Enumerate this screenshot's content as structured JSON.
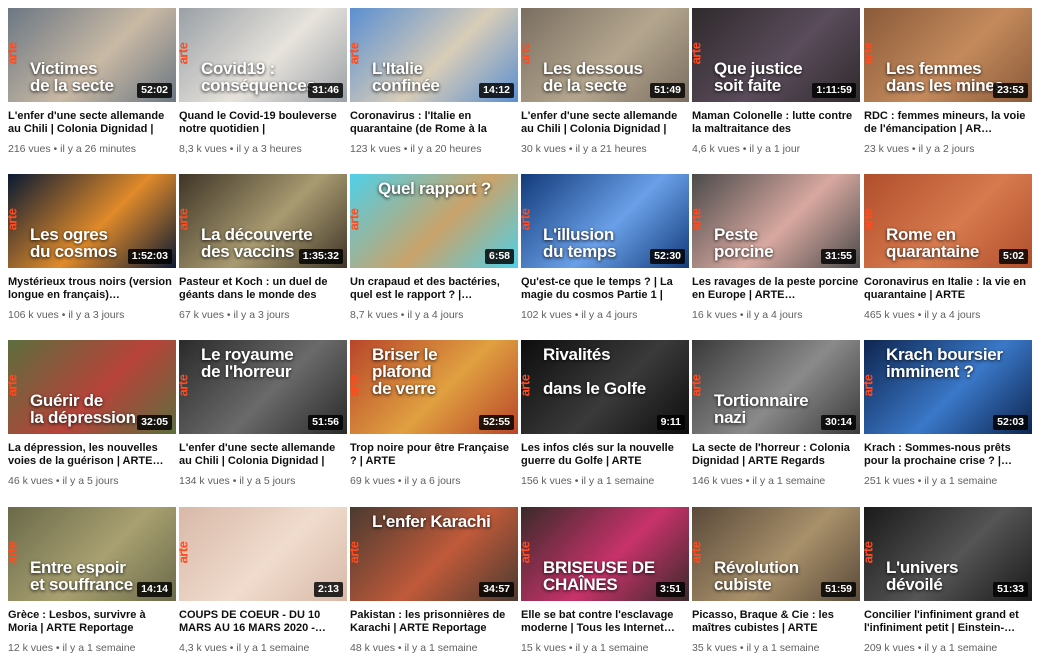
{
  "videos": [
    {
      "overlay": "Victimes\nde la secte",
      "duration": "52:02",
      "title": "L'enfer d'une secte allemande au Chili | Colonia Dignidad |",
      "views": "216 vues",
      "age": "il y a 26 minutes",
      "bg": "#6b7783",
      "accent": "#c9b9a4"
    },
    {
      "overlay": "Covid19 :\nconséquences",
      "duration": "31:46",
      "title": "Quand le Covid-19 bouleverse notre quotidien |",
      "views": "8,3 k vues",
      "age": "il y a 3 heures",
      "bg": "#9aa0a6",
      "accent": "#e7e3dc"
    },
    {
      "overlay": "L'Italie\nconfinée",
      "duration": "14:12",
      "title": "Coronavirus : l'Italie en quarantaine (de Rome à la",
      "views": "123 k vues",
      "age": "il y a 20 heures",
      "bg": "#5b8fd0",
      "accent": "#d8cdb8"
    },
    {
      "overlay": "Les dessous\nde la secte",
      "duration": "51:49",
      "title": "L'enfer d'une secte allemande au Chili | Colonia Dignidad |",
      "views": "30 k vues",
      "age": "il y a 21 heures",
      "bg": "#7a6e61",
      "accent": "#b4a68e"
    },
    {
      "overlay": "Que justice\nsoit faite",
      "duration": "1:11:59",
      "title": "Maman Colonelle : lutte contre la maltraitance des",
      "views": "4,6 k vues",
      "age": "il y a 1 jour",
      "bg": "#2f2a2c",
      "accent": "#5a4c5b"
    },
    {
      "overlay": "Les femmes\ndans les mines",
      "duration": "23:53",
      "title": "RDC : femmes mineurs, la voie de l'émancipation | AR…",
      "views": "23 k vues",
      "age": "il y a 2 jours",
      "bg": "#8a5a3a",
      "accent": "#c48a5c"
    },
    {
      "overlay": "Les ogres\ndu cosmos",
      "duration": "1:52:03",
      "title": "Mystérieux trous noirs (version longue en français)…",
      "views": "106 k vues",
      "age": "il y a 3 jours",
      "bg": "#0a1a33",
      "accent": "#e08a2a"
    },
    {
      "overlay": "La découverte\ndes vaccins",
      "duration": "1:35:32",
      "title": "Pasteur et Koch : un duel de géants dans le monde des",
      "views": "67 k vues",
      "age": "il y a 3 jours",
      "bg": "#3f3527",
      "accent": "#a89a70"
    },
    {
      "overlay": "Quel rapport ?",
      "duration": "6:58",
      "title": "Un crapaud et des bactéries, quel est le rapport ? |…",
      "views": "8,7 k vues",
      "age": "il y a 4 jours",
      "bg": "#4fd0e8",
      "accent": "#c9a36a",
      "top": true
    },
    {
      "overlay": "L'illusion\ndu temps",
      "duration": "52:30",
      "title": "Qu'est-ce que le temps ? | La magie du cosmos Partie 1 |",
      "views": "102 k vues",
      "age": "il y a 4 jours",
      "bg": "#123a7a",
      "accent": "#6aa0e8"
    },
    {
      "overlay": "Peste\nporcine",
      "duration": "31:55",
      "title": "Les ravages de la peste porcine en Europe | ARTE…",
      "views": "16 k vues",
      "age": "il y a 4 jours",
      "bg": "#4a4a4a",
      "accent": "#d8a8a0"
    },
    {
      "overlay": "Rome en\nquarantaine",
      "duration": "5:02",
      "title": "Coronavirus en Italie : la vie en quarantaine | ARTE",
      "views": "465 k vues",
      "age": "il y a 4 jours",
      "bg": "#b04e2c",
      "accent": "#d77a4e"
    },
    {
      "overlay": "Guérir de\nla dépression",
      "duration": "32:05",
      "title": "La dépression, les nouvelles voies de la guérison | ARTE…",
      "views": "46 k vues",
      "age": "il y a 5 jours",
      "bg": "#5c6e3d",
      "accent": "#b7433a"
    },
    {
      "overlay": "Le royaume\nde l'horreur",
      "duration": "51:56",
      "title": "L'enfer d'une secte allemande au Chili | Colonia Dignidad |",
      "views": "134 k vues",
      "age": "il y a 5 jours",
      "bg": "#2a2a2a",
      "accent": "#6a6a6a",
      "top": true
    },
    {
      "overlay": "Briser le\nplafond\nde verre",
      "duration": "52:55",
      "title": "Trop noire pour être Française ? | ARTE",
      "views": "69 k vues",
      "age": "il y a 6 jours",
      "bg": "#b8452a",
      "accent": "#e0a040",
      "top": true
    },
    {
      "overlay": "Rivalités\n\ndans le Golfe",
      "duration": "9:11",
      "title": "Les infos clés sur la nouvelle guerre du Golfe | ARTE",
      "views": "156 k vues",
      "age": "il y a 1 semaine",
      "bg": "#0d0d0d",
      "accent": "#3a3a3a",
      "top": true
    },
    {
      "overlay": "Tortionnaire\nnazi",
      "duration": "30:14",
      "title": "La secte de l'horreur : Colonia Dignidad | ARTE Regards",
      "views": "146 k vues",
      "age": "il y a 1 semaine",
      "bg": "#3a3a3a",
      "accent": "#8a8a8a"
    },
    {
      "overlay": "Krach boursier\nimminent ?",
      "duration": "52:03",
      "title": "Krach : Sommes-nous prêts pour la prochaine crise ? |…",
      "views": "251 k vues",
      "age": "il y a 1 semaine",
      "bg": "#0e2550",
      "accent": "#3a78c8",
      "top": true
    },
    {
      "overlay": "Entre espoir\net souffrance",
      "duration": "14:14",
      "title": "Grèce : Lesbos, survivre à Moria | ARTE Reportage",
      "views": "12 k vues",
      "age": "il y a 1 semaine",
      "bg": "#6a6a4a",
      "accent": "#a8a070"
    },
    {
      "overlay": "",
      "duration": "2:13",
      "title": "COUPS DE COEUR - DU 10 MARS AU 16 MARS 2020 -…",
      "views": "4,3 k vues",
      "age": "il y a 1 semaine",
      "bg": "#d8b8a8",
      "accent": "#f0dccd"
    },
    {
      "overlay": "L'enfer Karachi",
      "duration": "34:57",
      "title": "Pakistan : les prisonnières de Karachi | ARTE Reportage",
      "views": "48 k vues",
      "age": "il y a 1 semaine",
      "bg": "#4a3a30",
      "accent": "#c05a3a",
      "top": true
    },
    {
      "overlay": "BRISEUSE DE\nCHAÎNES",
      "duration": "3:51",
      "title": "Elle se bat contre l'esclavage moderne | Tous les Internet…",
      "views": "15 k vues",
      "age": "il y a 1 semaine",
      "bg": "#3a2a2a",
      "accent": "#c8326a"
    },
    {
      "overlay": "Révolution\ncubiste",
      "duration": "51:59",
      "title": "Picasso, Braque & Cie : les maîtres cubistes | ARTE",
      "views": "35 k vues",
      "age": "il y a 1 semaine",
      "bg": "#5a4a3a",
      "accent": "#a8906a"
    },
    {
      "overlay": "L'univers\ndévoilé",
      "duration": "51:33",
      "title": "Concilier l'infiniment grand et l'infiniment petit | Einstein-…",
      "views": "209 k vues",
      "age": "il y a 1 semaine",
      "bg": "#1a1a1a",
      "accent": "#555555"
    }
  ],
  "separator": " • ",
  "logo_text": "arte"
}
